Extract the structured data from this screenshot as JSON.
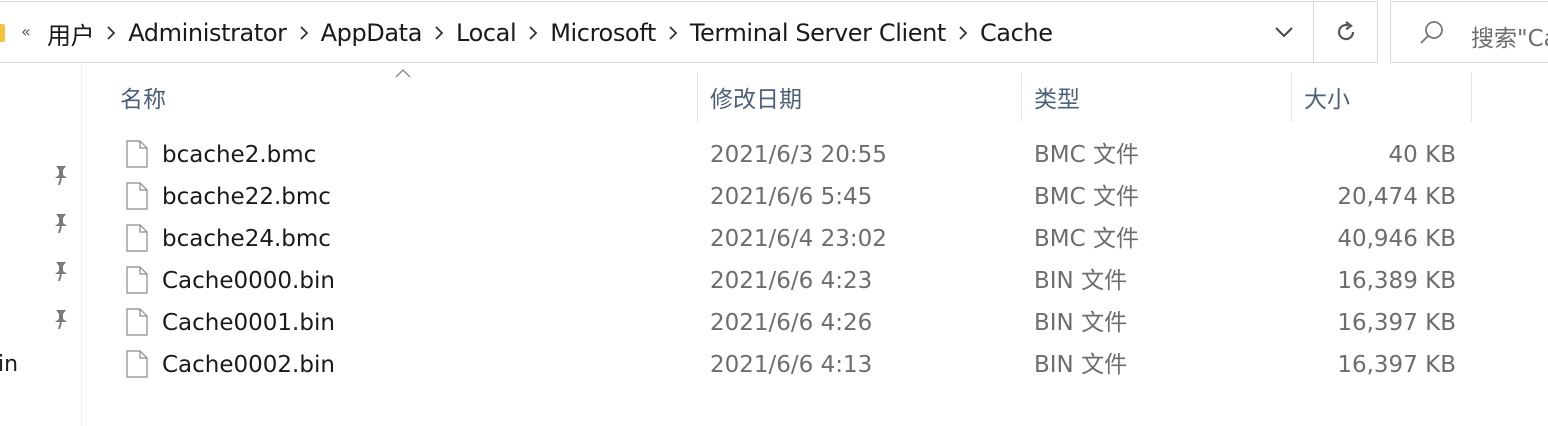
{
  "address_bar": {
    "overflow_symbol": "«",
    "breadcrumbs": [
      "用户",
      "Administrator",
      "AppData",
      "Local",
      "Microsoft",
      "Terminal Server Client",
      "Cache"
    ],
    "history_icon": "chevron-down-icon",
    "refresh_icon": "refresh-icon"
  },
  "search": {
    "placeholder": "搜索\"Cache\""
  },
  "nav_pane": {
    "partial_item_label": "in",
    "pinned_count": 4
  },
  "columns": {
    "name": "名称",
    "date": "修改日期",
    "type": "类型",
    "size": "大小",
    "sorted_by": "name"
  },
  "files": [
    {
      "name": "bcache2.bmc",
      "date": "2021/6/3 20:55",
      "type": "BMC 文件",
      "size": "40 KB"
    },
    {
      "name": "bcache22.bmc",
      "date": "2021/6/6 5:45",
      "type": "BMC 文件",
      "size": "20,474 KB"
    },
    {
      "name": "bcache24.bmc",
      "date": "2021/6/4 23:02",
      "type": "BMC 文件",
      "size": "40,946 KB"
    },
    {
      "name": "Cache0000.bin",
      "date": "2021/6/6 4:23",
      "type": "BIN 文件",
      "size": "16,389 KB"
    },
    {
      "name": "Cache0001.bin",
      "date": "2021/6/6 4:26",
      "type": "BIN 文件",
      "size": "16,397 KB"
    },
    {
      "name": "Cache0002.bin",
      "date": "2021/6/6 4:13",
      "type": "BIN 文件",
      "size": "16,397 KB"
    }
  ],
  "colors": {
    "header_text": "#4c607a",
    "muted_text": "#6d6d6d",
    "border": "#d9d9d9",
    "folder": "#f3c33e"
  }
}
